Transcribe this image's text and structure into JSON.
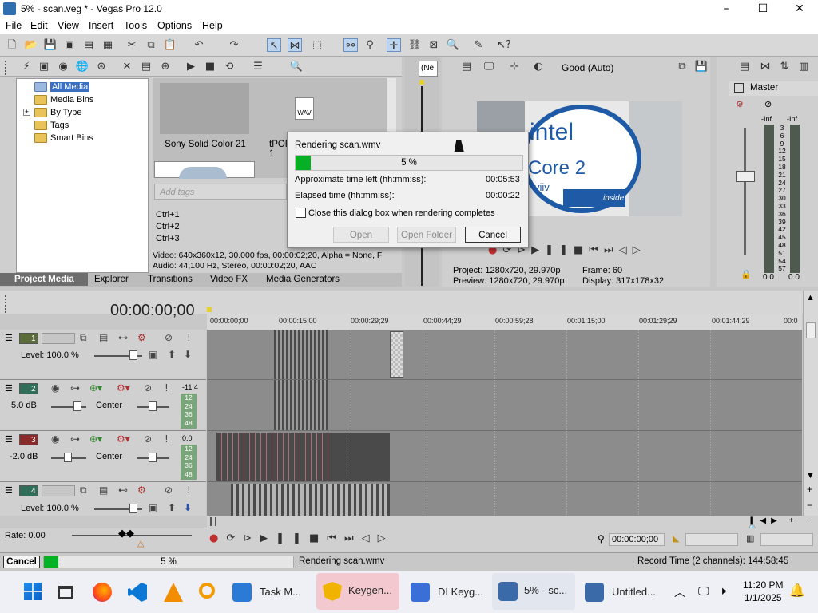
{
  "window": {
    "title": "5% - scan.veg * - Vegas Pro 12.0",
    "min": "–",
    "max": "☐",
    "close": "✕"
  },
  "menu": [
    "File",
    "Edit",
    "View",
    "Insert",
    "Tools",
    "Options",
    "Help"
  ],
  "explorer": {
    "tree": [
      "All Media",
      "Media Bins",
      "By Type",
      "Tags",
      "Smart Bins"
    ],
    "media_items": [
      {
        "label": "Sony Solid Color 21"
      },
      {
        "label": "tPOR\n1"
      }
    ],
    "wav_label": "WAV",
    "tags_placeholder": "Add tags",
    "shortcuts": [
      "Ctrl+1",
      "Ctrl+2",
      "Ctrl+3"
    ],
    "info_line1": "Video: 640x360x12, 30.000 fps, 00:00:02;20, Alpha = None, Fi",
    "info_line2": "Audio: 44,100 Hz, Stereo, 00:00:02;20, AAC",
    "tabs": [
      "Project Media",
      "Explorer",
      "Transitions",
      "Video FX",
      "Media Generators"
    ]
  },
  "preview": {
    "ne_label": "(Ne",
    "quality": "Good (Auto)",
    "project": "Project:   1280x720, 29.970p",
    "preview": "Preview:   1280x720, 29.970p",
    "frame": "Frame:      60",
    "display": "Display:    317x178x32",
    "intel_text": "intel",
    "core_text": "Core 2",
    "viiv_text": "viiv",
    "inside_text": "inside"
  },
  "master": {
    "title": "Master",
    "inf_left": "-Inf.",
    "inf_right": "-Inf.",
    "scale": [
      "3",
      "6",
      "9",
      "12",
      "15",
      "18",
      "21",
      "24",
      "27",
      "30",
      "33",
      "36",
      "39",
      "42",
      "45",
      "48",
      "51",
      "54",
      "57"
    ],
    "bottom_left": "0.0",
    "bottom_right": "0.0"
  },
  "render_dialog": {
    "title": "Rendering scan.wmv",
    "progress_label": "5 %",
    "progress": 0.05,
    "approx_label": "Approximate time left (hh:mm:ss):",
    "approx_value": "00:05:53",
    "elapsed_label": "Elapsed time (hh:mm:ss):",
    "elapsed_value": "00:00:22",
    "checkbox_label": "Close this dialog box when rendering completes",
    "open_btn": "Open",
    "open_folder_btn": "Open Folder",
    "cancel_btn": "Cancel"
  },
  "timeline": {
    "timecode": "00:00:00;00",
    "ruler": [
      "00:00:00;00",
      "00:00:15;00",
      "00:00:29;29",
      "00:00:44;29",
      "00:00:59;28",
      "00:01:15;00",
      "00:01:29;29",
      "00:01:44;29",
      "00:0"
    ],
    "tracks": [
      {
        "num": "1",
        "type": "video",
        "label1": "Level: 100.0 %",
        "label2": ""
      },
      {
        "num": "2",
        "type": "audio",
        "label1": "5.0 dB",
        "label2": "Center",
        "peak": "-11.4"
      },
      {
        "num": "3",
        "type": "audio",
        "label1": "-2.0 dB",
        "label2": "Center",
        "peak": "0.0"
      },
      {
        "num": "4",
        "type": "video",
        "label1": "Level: 100.0 %",
        "label2": ""
      }
    ],
    "meter_marks": [
      "12",
      "24",
      "36",
      "48"
    ],
    "rate": "Rate: 0.00",
    "transport_time": "00:00:00;00"
  },
  "statusbar": {
    "cancel": "Cancel",
    "progress_label": "5 %",
    "progress": 0.05,
    "message": "Rendering scan.wmv",
    "record_time": "Record Time (2 channels): 144:58:45"
  },
  "taskbar": {
    "apps": [
      {
        "label": "Task M...",
        "color": "#2b7bd6"
      },
      {
        "label": "Keygen...",
        "color": "#f0b400"
      },
      {
        "label": "DI Keyg...",
        "color": "#3a6fd8"
      },
      {
        "label": "5% - sc...",
        "color": "#3b6aa8"
      },
      {
        "label": "Untitled...",
        "color": "#3b6aa8"
      }
    ],
    "time": "11:20 PM",
    "date": "1/1/2025"
  }
}
